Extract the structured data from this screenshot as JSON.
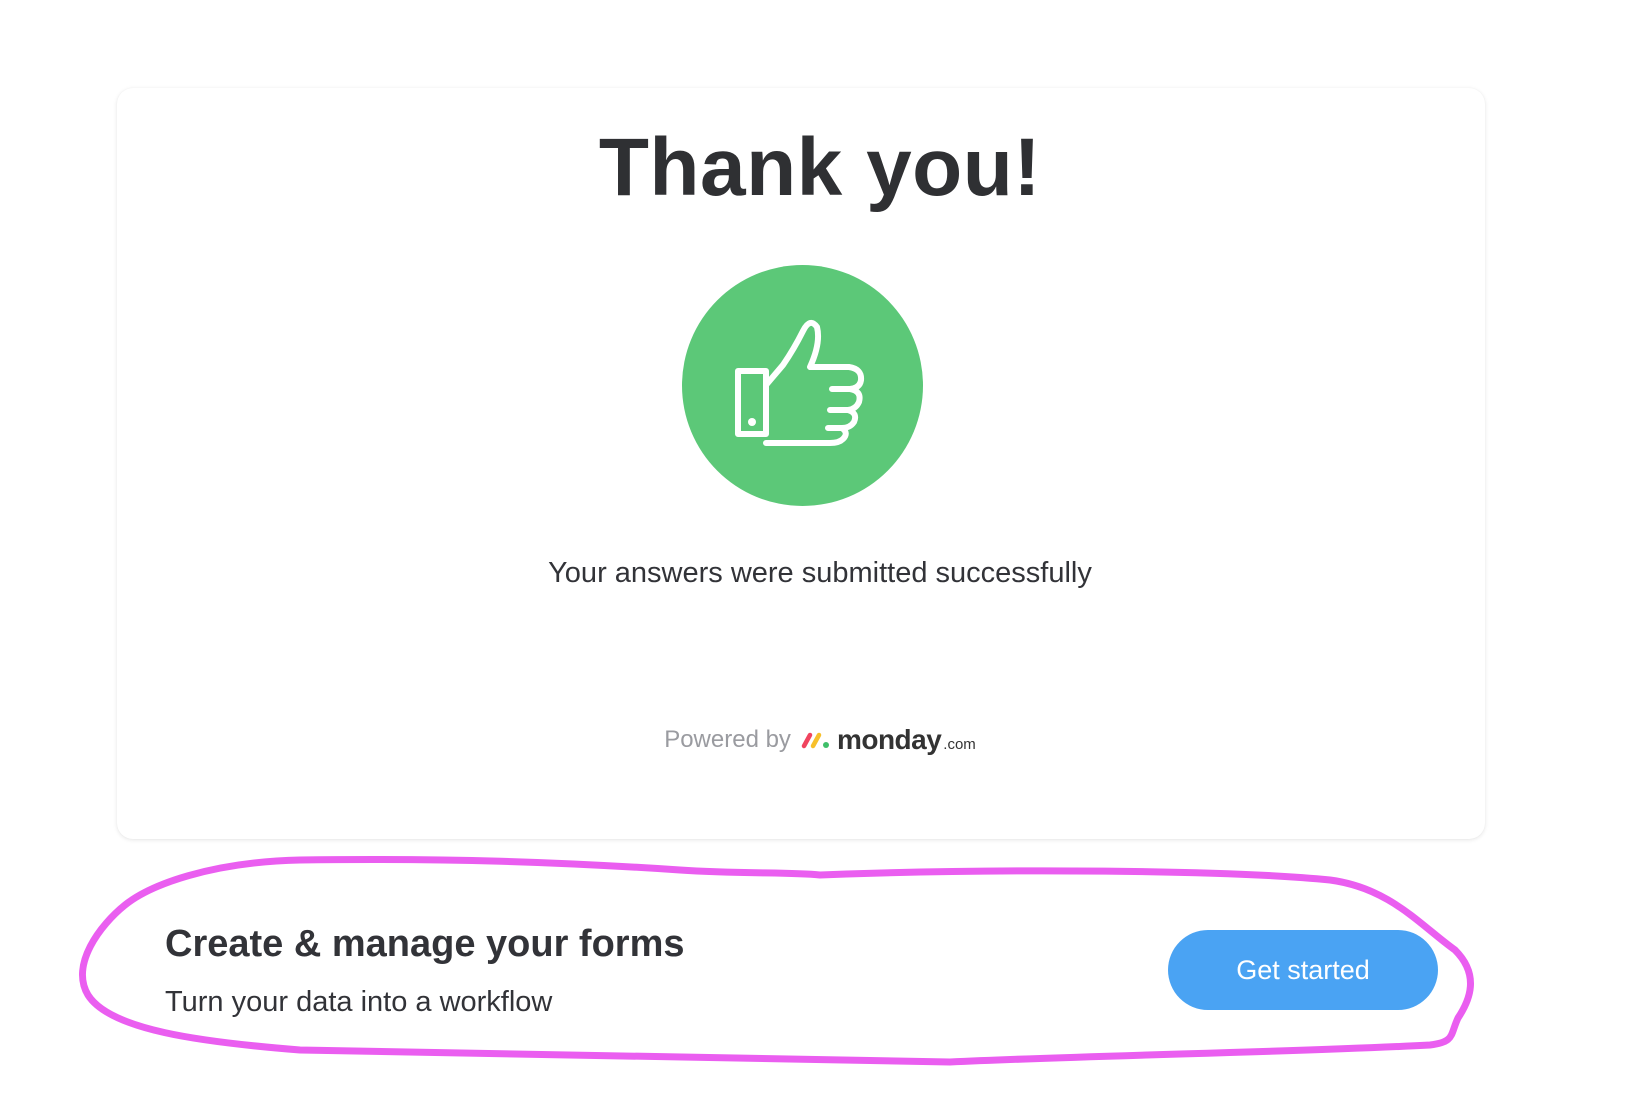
{
  "colors": {
    "success": "#5cc878",
    "accent": "#4aa3f3",
    "annotation": "#ea5ef0",
    "text": "#323338",
    "muted": "#9a9ba0"
  },
  "confirmation": {
    "title": "Thank you!",
    "icon": "thumbs-up-icon",
    "message": "Your answers were submitted successfully",
    "powered_by": "Powered by",
    "brand_name": "monday",
    "brand_suffix": ".com"
  },
  "promo": {
    "title": "Create & manage your forms",
    "subtitle": "Turn your data into a workflow",
    "cta_label": "Get started"
  }
}
